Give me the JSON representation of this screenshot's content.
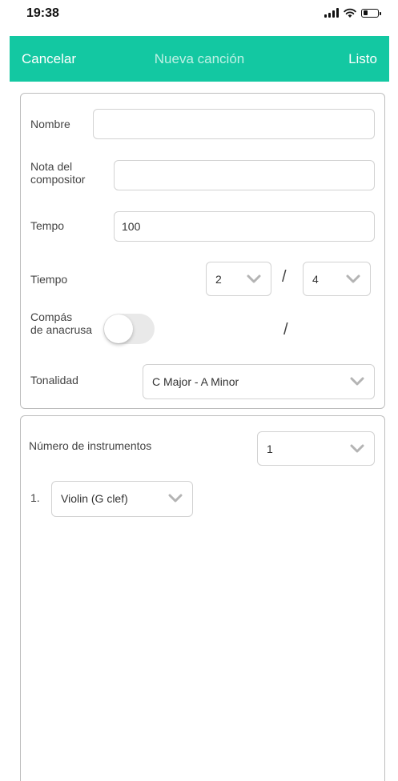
{
  "status_bar": {
    "time": "19:38",
    "battery_level": 0.35
  },
  "header": {
    "cancel_label": "Cancelar",
    "title": "Nueva canción",
    "done_label": "Listo"
  },
  "song_form": {
    "name_label": "Nombre",
    "name_value": "",
    "composer_note_label_line1": "Nota del",
    "composer_note_label_line2": "compositor",
    "composer_note_value": "",
    "tempo_label": "Tempo",
    "tempo_value": "100",
    "time_label": "Tiempo",
    "time_numerator": "2",
    "time_separator": "/",
    "time_denominator": "4",
    "pickup_label_line1": "Compás",
    "pickup_label_line2": "de anacrusa",
    "pickup_enabled": false,
    "pickup_separator": "/",
    "key_label": "Tonalidad",
    "key_value": "C Major - A Minor"
  },
  "instruments": {
    "count_label": "Número de instrumentos",
    "count_value": "1",
    "items": [
      {
        "index": "1.",
        "instrument": "Violin (G clef)"
      }
    ]
  },
  "colors": {
    "accent": "#13c8a2",
    "header_title": "#bff1e5",
    "border": "#bdbdbd",
    "chevron": "#b4b4b4"
  }
}
